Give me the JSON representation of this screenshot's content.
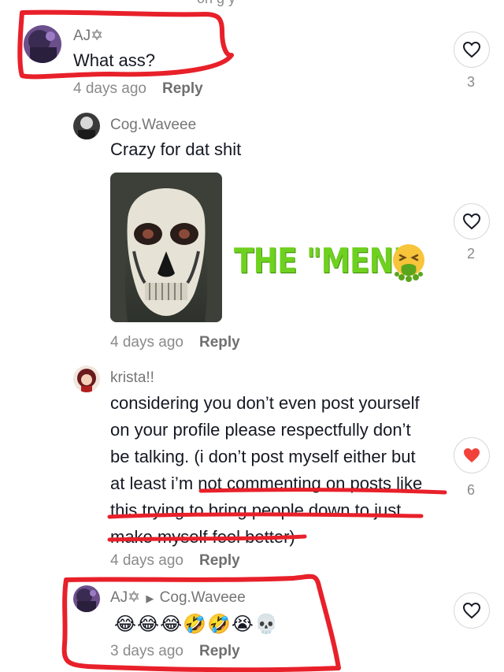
{
  "top_fragment": "on      g     y",
  "comments": [
    {
      "username": "AJ✡",
      "text": "What ass?",
      "time": "4 days ago",
      "reply_label": "Reply",
      "likes": "3"
    },
    {
      "username": "Cog.Waveee",
      "text": "Crazy for dat shit",
      "sticker_text": "THE \"MEN\"",
      "sticker_emoji": "🤮",
      "time": "4 days ago",
      "reply_label": "Reply",
      "likes": "2"
    },
    {
      "username": "krista!!",
      "lines": [
        "considering you don’t even post yourself",
        "on your profile please respectfully don’t",
        "be talking. (i don’t post myself either but",
        "at least i’m not commenting on posts like",
        "this trying to bring people down to just",
        "make myself feel better)"
      ],
      "time": "4 days ago",
      "reply_label": "Reply",
      "likes": "6",
      "liked": true
    },
    {
      "username": "AJ✡",
      "reply_to": "Cog.Waveee",
      "text": "😂😂😂🤣🤣😭💀",
      "time": "3 days ago",
      "reply_label": "Reply"
    }
  ],
  "colors": {
    "annotation_red": "#e8202a",
    "heart_liked": "#f2413a",
    "sticker_green": "#6fd11f"
  }
}
